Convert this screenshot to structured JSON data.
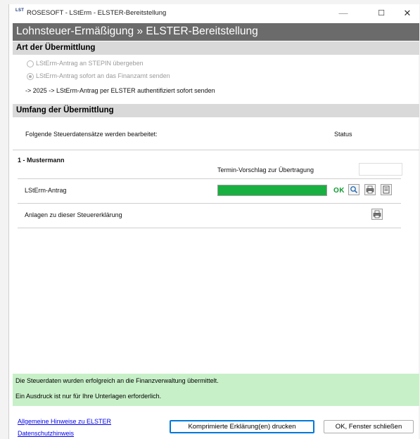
{
  "window": {
    "icon_text": "LST",
    "title": "ROSESOFT - LStErm - ELSTER-Bereitstellung",
    "controls": {
      "minimize": "—",
      "maximize": "☐",
      "close": "✕"
    }
  },
  "header": {
    "title": "Lohnsteuer-Ermäßigung » ELSTER-Bereitstellung"
  },
  "section_transmission": {
    "title": "Art der Übermittlung",
    "options": [
      {
        "label": "LStErm-Antrag an STEPIN übergeben",
        "selected": false,
        "enabled": false
      },
      {
        "label": "LStErm-Antrag sofort an das Finanzamt senden",
        "selected": true,
        "enabled": false
      }
    ],
    "info": "-> 2025 -> LStErm-Antrag per ELSTER authentifiziert sofort senden"
  },
  "section_scope": {
    "title": "Umfang der Übermittlung",
    "intro": "Folgende Steuerdatensätze werden bearbeitet:",
    "status_header": "Status",
    "person": "1 - Mustermann",
    "termin_label": "Termin-Vorschlag zur Übertragung",
    "termin_value": "",
    "rows": [
      {
        "label": "LStErm-Antrag",
        "progress": 1.0,
        "status": "OK",
        "icons": [
          "preview-icon",
          "print-icon",
          "document-icon"
        ]
      },
      {
        "label": "Anlagen zu dieser Steuererklärung",
        "icons": [
          "print-icon"
        ]
      }
    ]
  },
  "message": {
    "line1": "Die Steuerdaten wurden erfolgreich an die Finanzverwaltung übermittelt.",
    "line2": "Ein Ausdruck ist nur für Ihre Unterlagen erforderlich."
  },
  "footer": {
    "link1": "Allgemeine Hinweise zu ELSTER",
    "link2": "Datenschutzhinweis",
    "print_button": "Komprimierte Erklärung(en) drucken",
    "close_button": "OK, Fenster schließen"
  },
  "colors": {
    "header_bg": "#6b6b6b",
    "section_bg": "#d9d9d9",
    "progress_fill": "#18b040",
    "ok_text": "#0e9a2e",
    "message_bg": "#c8f0c8",
    "link": "#0000ee",
    "focus_border": "#0078d7"
  }
}
